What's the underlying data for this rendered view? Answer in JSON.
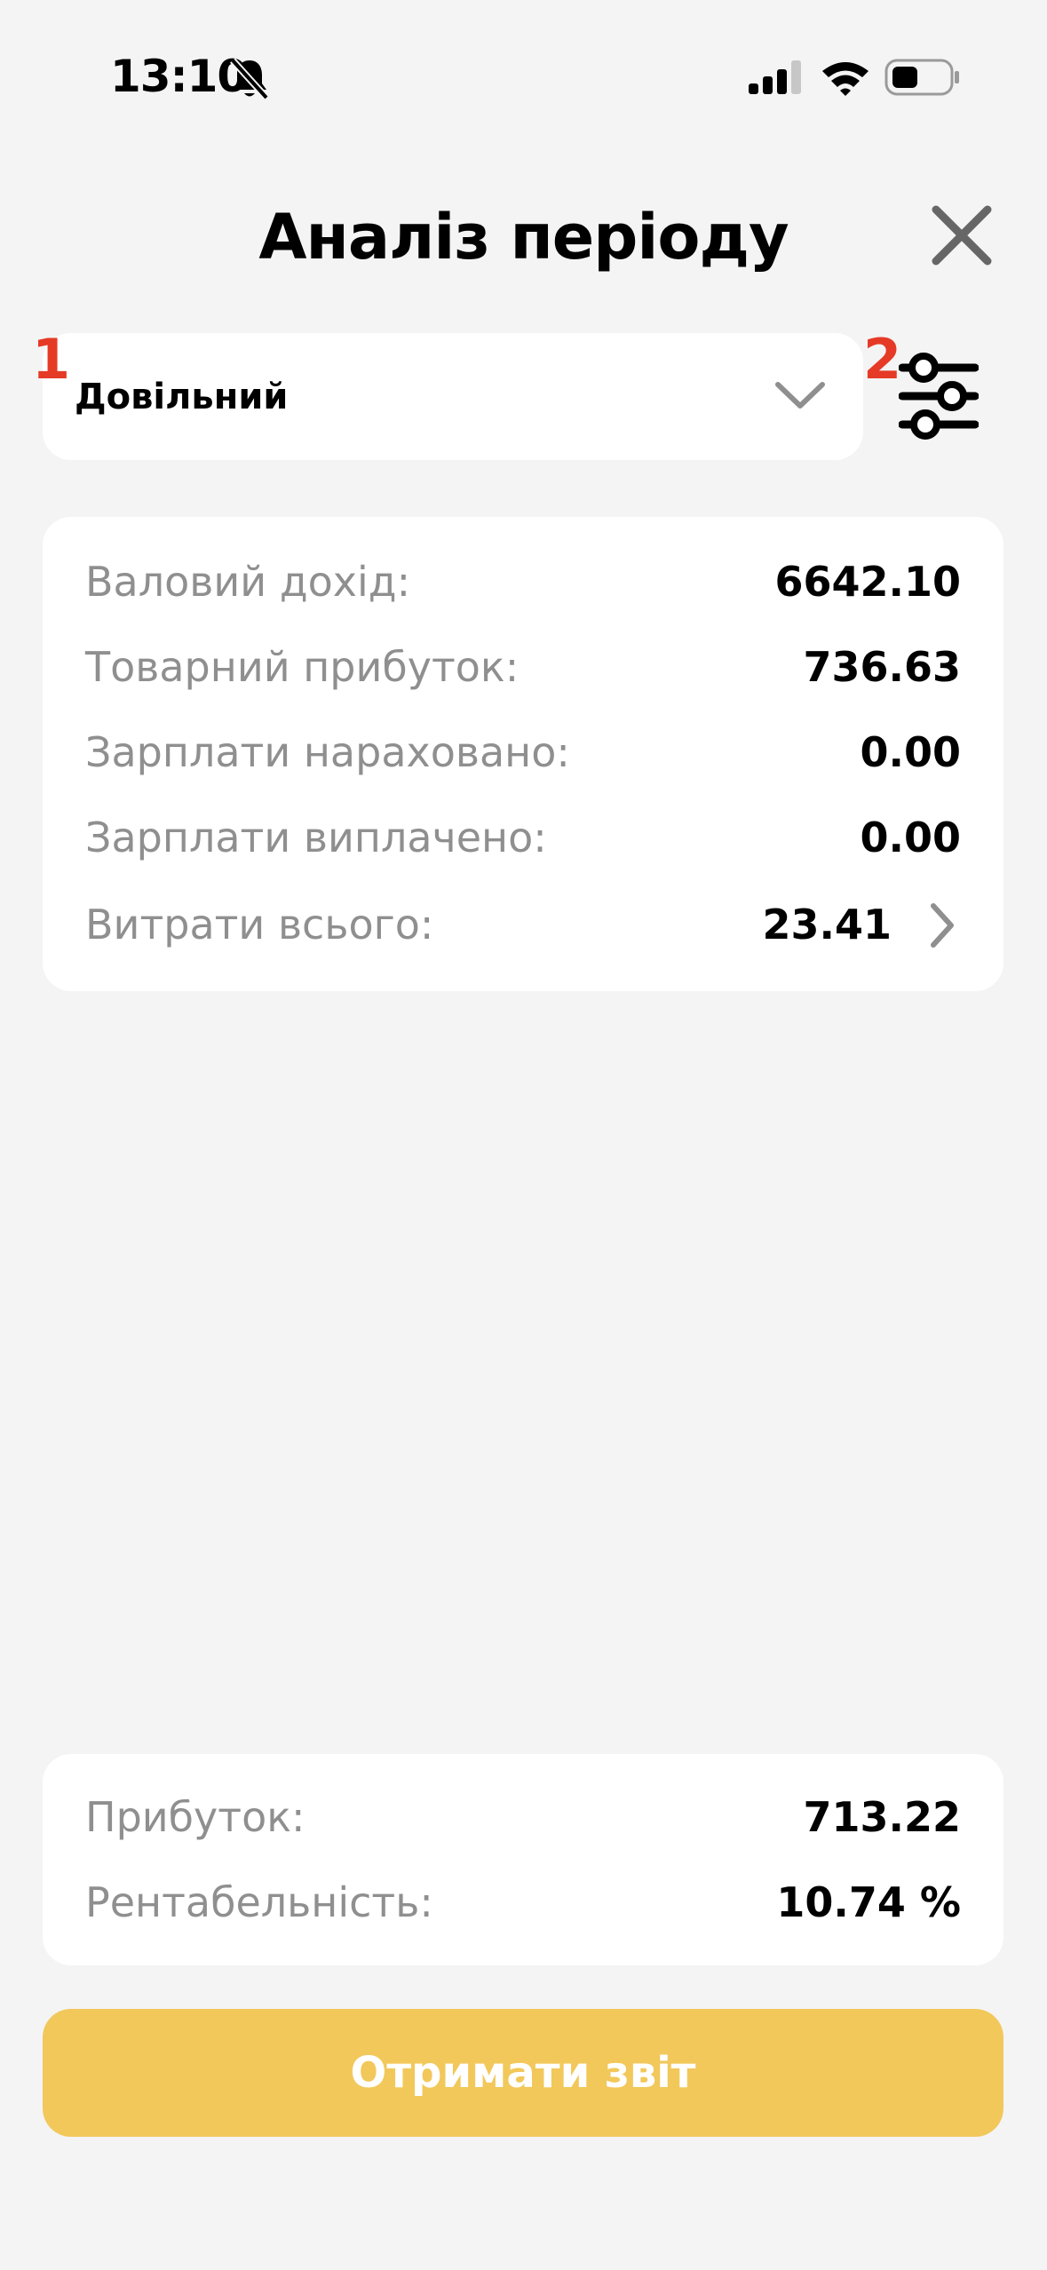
{
  "status_bar": {
    "time": "13:10"
  },
  "header": {
    "title": "Аналіз періоду"
  },
  "annotations": {
    "marker_1": "1",
    "marker_2": "2"
  },
  "period_selector": {
    "selected": "Довільний"
  },
  "stats": [
    {
      "label": "Валовий дохід:",
      "value": "6642.10"
    },
    {
      "label": "Товарний прибуток:",
      "value": "736.63"
    },
    {
      "label": "Зарплати нараховано:",
      "value": "0.00"
    },
    {
      "label": "Зарплати виплачено:",
      "value": "0.00"
    },
    {
      "label": "Витрати всього:",
      "value": "23.41"
    }
  ],
  "summary": [
    {
      "label": "Прибуток:",
      "value": "713.22"
    },
    {
      "label": "Рентабельність:",
      "value": "10.74 %"
    }
  ],
  "actions": {
    "report_button": "Отримати звіт"
  },
  "colors": {
    "accent": "#f2c85b",
    "marker": "#e53a26",
    "background": "#f4f4f4"
  },
  "icons": {
    "bell": "bell-slash-icon",
    "signal": "cellular-signal-icon",
    "wifi": "wifi-icon",
    "battery": "battery-icon",
    "close": "close-icon",
    "dropdown": "chevron-down-icon",
    "filter": "sliders-icon",
    "row_arrow": "chevron-right-icon"
  }
}
